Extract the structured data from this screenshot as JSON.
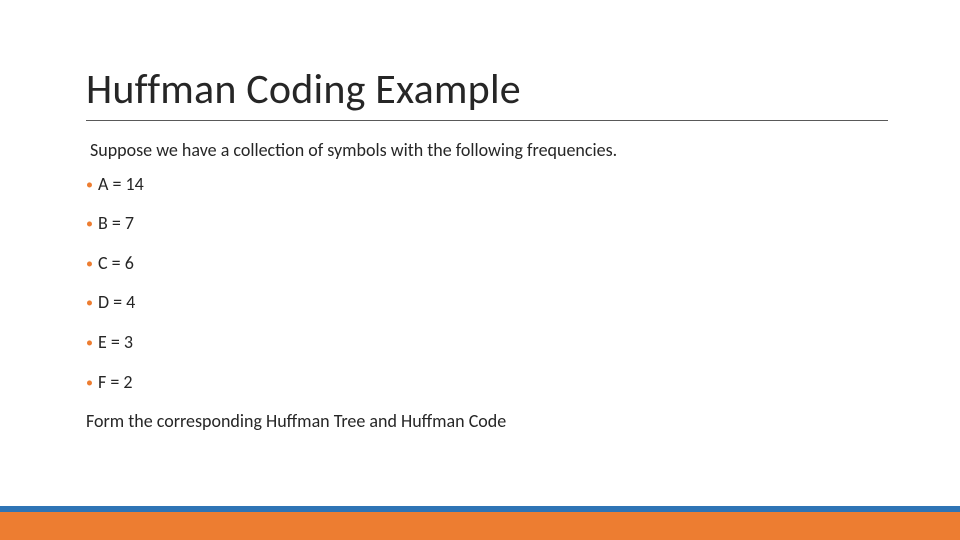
{
  "title": "Huffman Coding Example",
  "intro": "Suppose we have a collection of symbols with the following frequencies.",
  "frequencies": [
    {
      "label": "A = 14"
    },
    {
      "label": "B = 7"
    },
    {
      "label": "C = 6"
    },
    {
      "label": "D = 4"
    },
    {
      "label": "E = 3"
    },
    {
      "label": "F = 2"
    }
  ],
  "instruction": "Form the corresponding Huffman Tree and Huffman Code",
  "colors": {
    "accent_orange": "#ed7d31",
    "accent_blue": "#2e74b5",
    "rule": "#595959"
  }
}
